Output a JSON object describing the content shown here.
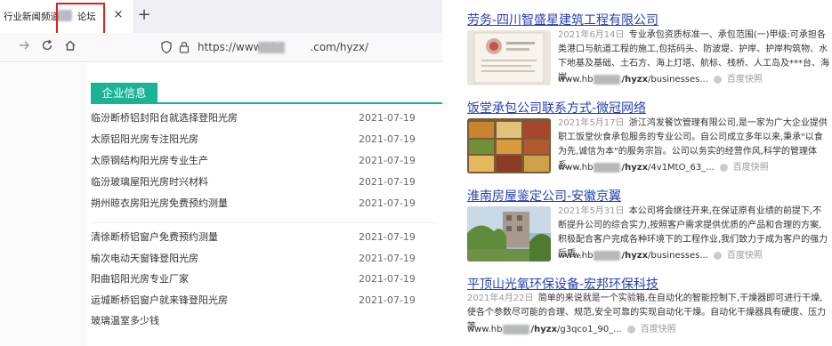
{
  "browser": {
    "tab_title": "行业新闻频道-",
    "tab_title_suffix": "论坛",
    "close_glyph": "×",
    "new_tab_glyph": "+",
    "url_prefix": "https://www.hb",
    "url_suffix": ".com/hyzx/"
  },
  "section": {
    "label": "企业信息",
    "accent_color": "#1ab394"
  },
  "news": [
    {
      "title": "临汾断桥铝封阳台就选择登阳光房",
      "date": "2021-07-19"
    },
    {
      "title": "太原铝阳光房专注阳光房",
      "date": "2021-07-19"
    },
    {
      "title": "太原钢结构阳光房专业生产",
      "date": "2021-07-19"
    },
    {
      "title": "临汾玻璃屋阳光房时兴材料",
      "date": "2021-07-19"
    },
    {
      "title": "朔州晾衣房阳光房免费预约测量",
      "date": "2021-07-19"
    },
    {
      "title": "清徐断桥铝窗户免费预约测量",
      "date": "2021-07-19"
    },
    {
      "title": "榆次电动天窗锋登阳光房",
      "date": "2021-07-19"
    },
    {
      "title": "阳曲铝阳光房专业厂家",
      "date": "2021-07-19"
    },
    {
      "title": "运城断桥铝窗户就来锋登阳光房",
      "date": "2021-07-19"
    },
    {
      "title": "玻璃温室多少钱",
      "date": ""
    }
  ],
  "results": [
    {
      "title": "劳务-四川智盛星建筑工程有限公司",
      "date": "2021年6月14日",
      "desc": "专业承包资质标准一、承包范围(一)甲级:可承担各类港口与航道工程的施工,包括码头、防波堤、护岸、护岸构筑物、水下地基及基础、土石方、海上灯塔、航标、栈桥、人工岛及***台、海岸...",
      "url_prefix": "www.hb",
      "url_bold": "/hyzx",
      "url_suffix": "/businesses...",
      "cache": "百度快照"
    },
    {
      "title": "饭堂承包公司联系方式-微冠网络",
      "date": "2021年5月17日",
      "desc": "浙江鸿发餐饮管理有限公司,是一家为广大企业提供职工饭堂伙食承包服务的专业公司。自公司成立多年以来,秉承\"以食为先,诚信为本\"的服务宗旨。公司以务实的经营作风,科学的管理体系,...",
      "url_prefix": "www.hb",
      "url_bold": "/hyzx",
      "url_suffix": "/4v1MtO_63_...",
      "cache": "百度快照"
    },
    {
      "title": "淮南房屋鉴定公司-安徽京翼",
      "date": "2021年5月31日",
      "desc": "本公司将会继往开来,在保证原有业绩的前提下,不断提升公司的综合实力,按照客户需求提供优质的产品和合理的方案,积极配合客户完成各种环境下的工程作业,我们致力于成为客户的强力后盾...",
      "url_prefix": "www.hb",
      "url_bold": "/hyzx",
      "url_suffix": "/businesses...",
      "cache": "百度快照"
    },
    {
      "title": "平顶山光氧环保设备-宏邦环保科技",
      "date": "2021年4月22日",
      "desc": "简单的来说就是一个实验箱,在自动化的智能控制下,干燥器即可进行干燥,使各个参数尽可能的合理、规范,安全可靠的实现自动化干燥。自动化干燥器具有硬度、压力等...",
      "url_prefix": "www.hb",
      "url_bold": "/hyzx",
      "url_suffix": "/g3qco1_90_...",
      "cache": "百度快照"
    }
  ],
  "colors": {
    "link": "#2440b3",
    "highlight_box": "#e0201d"
  }
}
